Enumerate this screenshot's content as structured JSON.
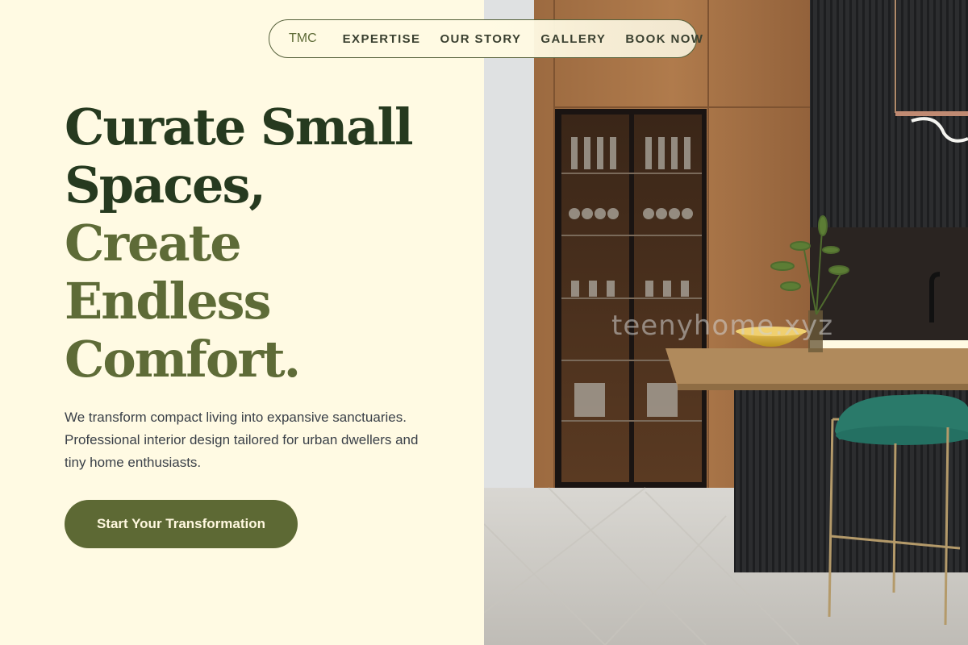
{
  "nav": {
    "logo": "TMC",
    "links": [
      "EXPERTISE",
      "OUR STORY",
      "GALLERY",
      "BOOK NOW"
    ]
  },
  "hero": {
    "headline_lines": [
      "Curate Small",
      "Spaces,",
      "Create",
      "Endless",
      "Comfort."
    ],
    "subtitle": "We transform compact living into expansive sanctuaries. Professional interior design tailored for urban dwellers and tiny home enthusiasts.",
    "cta_label": "Start Your Transformation"
  },
  "image": {
    "watermark": "teenyhome.xyz"
  },
  "colors": {
    "background": "#fffae3",
    "heading_dark": "#263a1f",
    "heading_olive": "#5e6b37",
    "cta_background": "#5d6934",
    "cta_text": "#fff8df"
  }
}
